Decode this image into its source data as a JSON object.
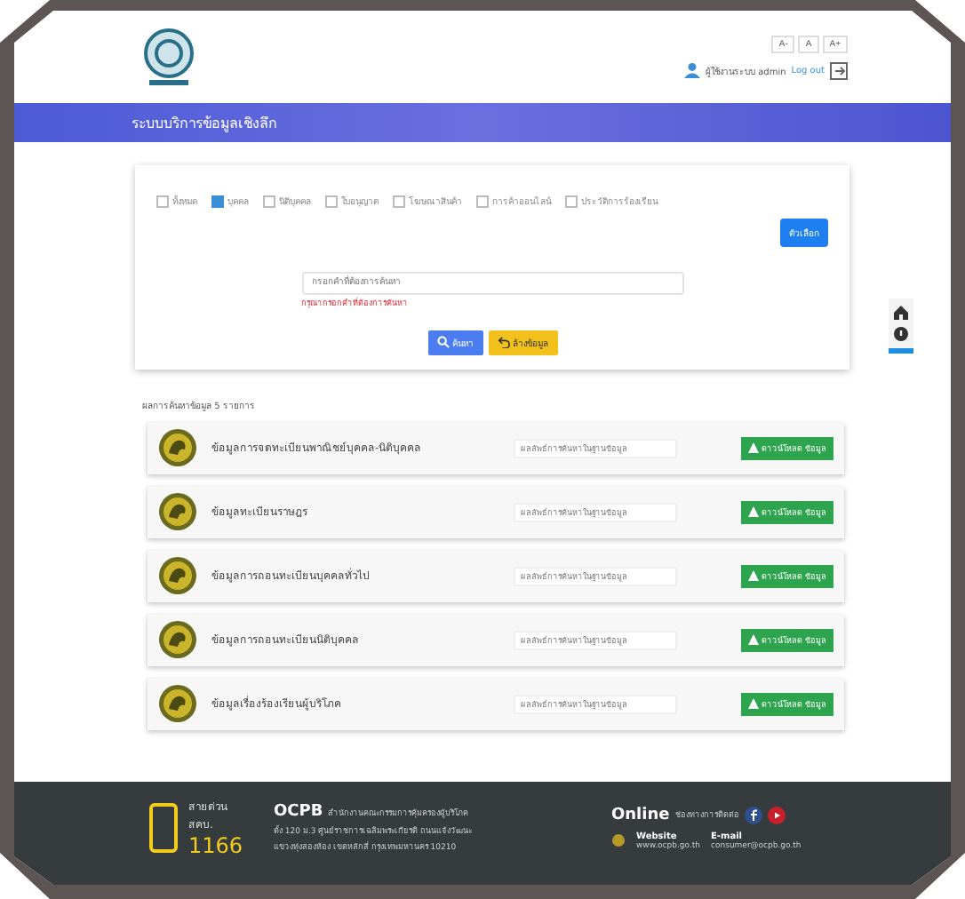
{
  "header": {
    "font_sizes": [
      "A-",
      "A",
      "A+"
    ],
    "user": "ผู้ใช้งานระบบ admin",
    "logout": "Log out"
  },
  "banner": {
    "title": "ระบบบริการข้อมูลเชิงลึก"
  },
  "filters": [
    {
      "label": "ทั้งหมด",
      "checked": false
    },
    {
      "label": "บุคคล",
      "checked": true
    },
    {
      "label": "นิติบุคคล",
      "checked": false
    },
    {
      "label": "ใบอนุญาต",
      "checked": false
    },
    {
      "label": "โฆษณาสินค้า",
      "checked": false
    },
    {
      "label": "การค้าออนไลน์",
      "checked": false
    },
    {
      "label": "ประวัติการร้องเรียน",
      "checked": false
    }
  ],
  "options_button": "ตัวเลือก",
  "search": {
    "placeholder": "กรอกคำที่ต้องการค้นหา",
    "error": "กรุณากรอกคำที่ต้องการค้นหา",
    "search_button": "ค้นหา",
    "clear_button": "ล้างข้อมูล"
  },
  "results": {
    "summary": "ผลการค้นหาข้อมูล 5 รายการ",
    "rows": [
      {
        "title": "ข้อมูลการจดทะเบียนพาณิชย์บุคคล-นิติบุคคล",
        "placeholder": "ผลลัพธ์การค้นหาในฐานข้อมูล",
        "button": "ดาวน์โหลด ข้อมูล"
      },
      {
        "title": "ข้อมูลทะเบียนราษฎร",
        "placeholder": "ผลลัพธ์การค้นหาในฐานข้อมูล",
        "button": "ดาวน์โหลด ข้อมูล"
      },
      {
        "title": "ข้อมูลการถอนทะเบียนบุคคลทั่วไป",
        "placeholder": "ผลลัพธ์การค้นหาในฐานข้อมูล",
        "button": "ดาวน์โหลด ข้อมูล"
      },
      {
        "title": "ข้อมูลการถอนทะเบียนนิติบุคคล",
        "placeholder": "ผลลัพธ์การค้นหาในฐานข้อมูล",
        "button": "ดาวน์โหลด ข้อมูล"
      },
      {
        "title": "ข้อมูลเรื่องร้องเรียนผู้บริโภค",
        "placeholder": "ผลลัพธ์การค้นหาในฐานข้อมูล",
        "button": "ดาวน์โหลด ข้อมูล"
      }
    ]
  },
  "footer": {
    "hotline_label": "สายด่วน สคบ.",
    "hotline": "1166",
    "org": "OCPB",
    "org_name": "สำนักงานคณะกรรมการคุ้มครองผู้บริโภค",
    "address": [
      "ตั้ง 120 ม.3 ศูนย์ราชการเฉลิมพระเกียรติ ถนนแจ้งวัฒนะ",
      "แขวงทุ่งสองห้อง เขตหลักสี่ กรุงเทพมหานคร 10210"
    ],
    "online": "Online",
    "online_note": "ช่องทางการติดต่อ",
    "website_label": "Website",
    "website": "www.ocpb.go.th",
    "email_label": "E-mail",
    "email": "consumer@ocpb.go.th"
  }
}
